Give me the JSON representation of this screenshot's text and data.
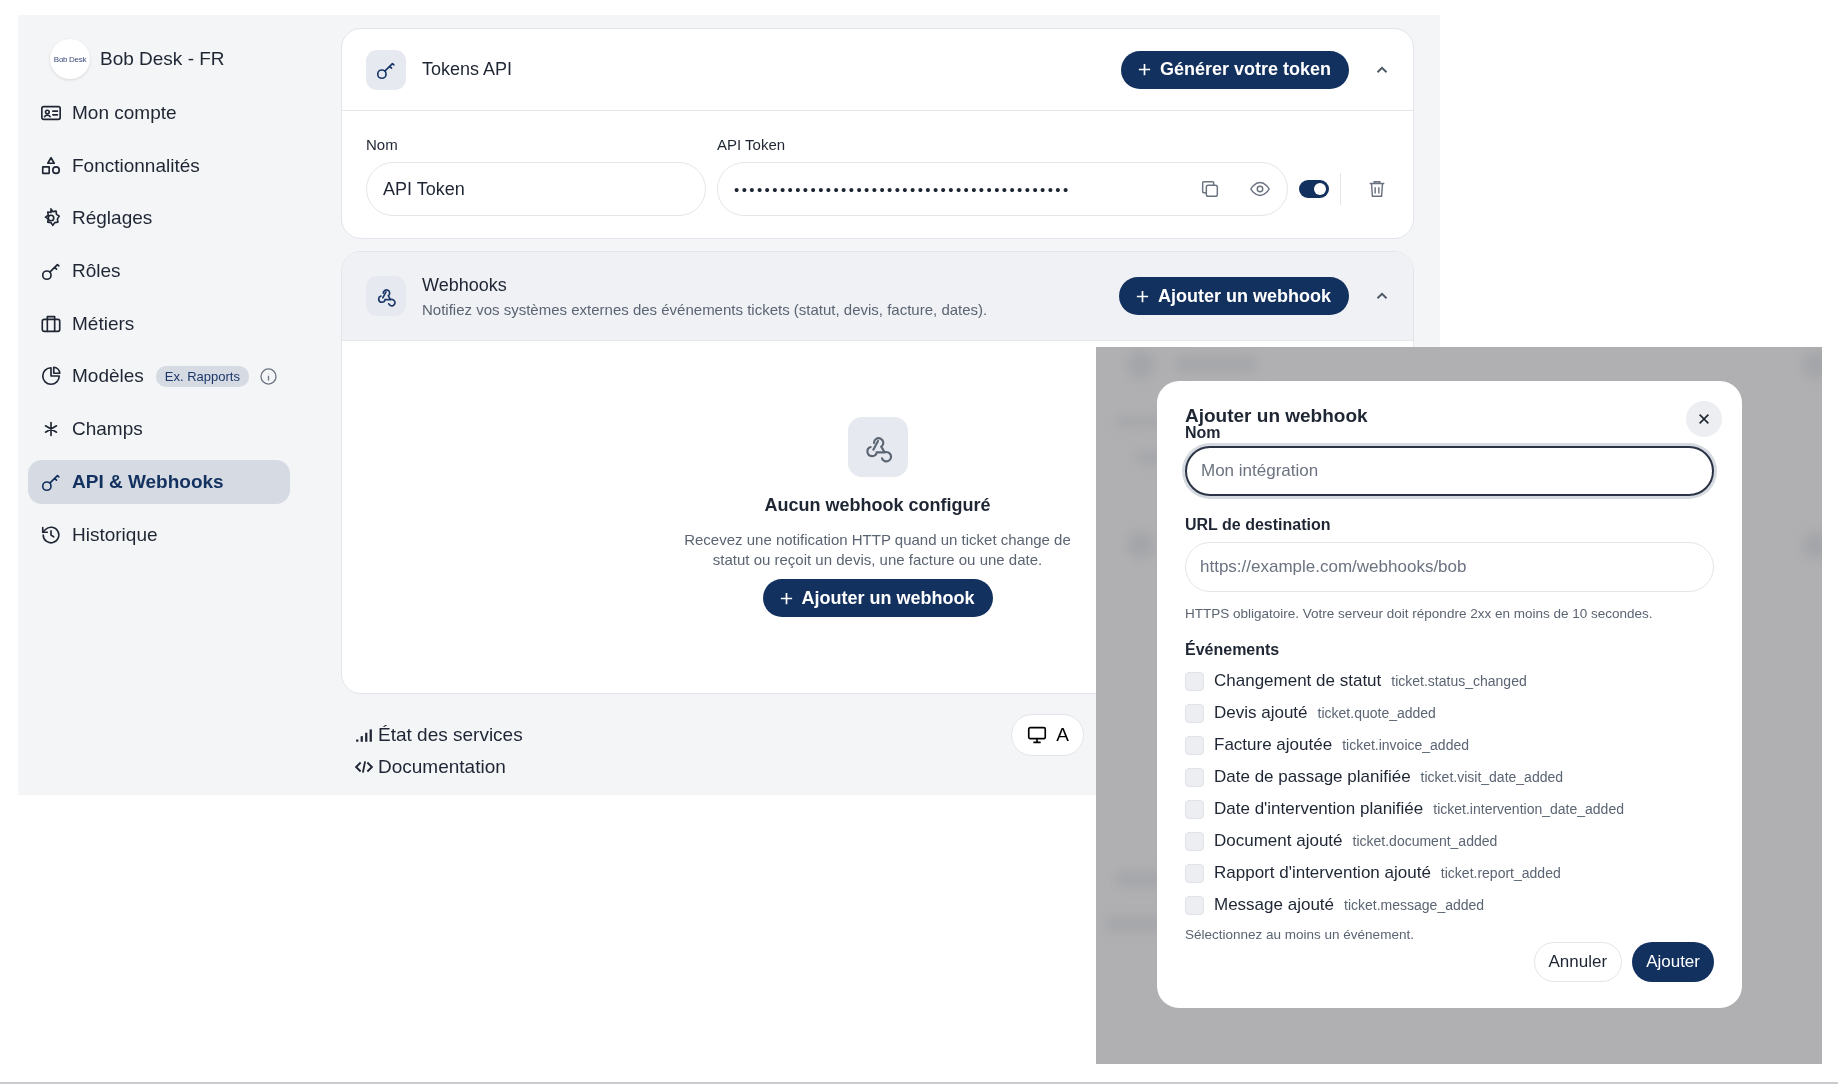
{
  "sidebar": {
    "brand": {
      "logo": "Bob Desk",
      "name": "Bob Desk - FR"
    },
    "items": [
      {
        "label": "Mon compte",
        "selected": false
      },
      {
        "label": "Fonctionnalités",
        "selected": false
      },
      {
        "label": "Réglages",
        "selected": false
      },
      {
        "label": "Rôles",
        "selected": false
      },
      {
        "label": "Métiers",
        "selected": false
      },
      {
        "label": "Modèles",
        "badge": "Ex. Rapports",
        "info": true,
        "selected": false
      },
      {
        "label": "Champs",
        "selected": false
      },
      {
        "label": "API & Webhooks",
        "selected": true
      },
      {
        "label": "Historique",
        "selected": false
      }
    ]
  },
  "tokens": {
    "title": "Tokens API",
    "button": "Générer votre token",
    "expanded": true,
    "columns": [
      "Nom",
      "API Token"
    ],
    "rows": [
      {
        "name": "API Token",
        "token": "••••••••••••••••••••••••••••••••••••••••••••",
        "enabled": true
      }
    ]
  },
  "webhooks": {
    "title": "Webhooks",
    "subtitle": "Notifiez vos systèmes externes des événements tickets (statut, devis, facture, dates).",
    "button": "Ajouter un webhook",
    "expanded": true,
    "empty": {
      "title": "Aucun webhook configuré",
      "text": "Recevez une notification HTTP quand un ticket change de statut ou reçoit un devis, une facture ou une date.",
      "button": "Ajouter un webhook"
    }
  },
  "footer": {
    "links": [
      "État des services",
      "Documentation"
    ],
    "button": "A"
  },
  "modal": {
    "title": "Ajouter un webhook",
    "fields": [
      {
        "label": "Nom",
        "placeholder": "Mon intégration",
        "focused": true
      },
      {
        "label": "URL de destination",
        "placeholder": "https://example.com/webhooks/bob",
        "focused": false
      }
    ],
    "hint": "HTTPS obligatoire. Votre serveur doit répondre 2xx en moins de 10 secondes.",
    "events_label": "Événements",
    "events": [
      {
        "label": "Changement de statut",
        "code": "ticket.status_changed",
        "checked": false
      },
      {
        "label": "Devis ajouté",
        "code": "ticket.quote_added",
        "checked": false
      },
      {
        "label": "Facture ajoutée",
        "code": "ticket.invoice_added",
        "checked": false
      },
      {
        "label": "Date de passage planifiée",
        "code": "ticket.visit_date_added",
        "checked": false
      },
      {
        "label": "Date d'intervention planifiée",
        "code": "ticket.intervention_date_added",
        "checked": false
      },
      {
        "label": "Document ajouté",
        "code": "ticket.document_added",
        "checked": false
      },
      {
        "label": "Rapport d'intervention ajouté",
        "code": "ticket.report_added",
        "checked": false
      },
      {
        "label": "Message ajouté",
        "code": "ticket.message_added",
        "checked": false
      }
    ],
    "error": "Sélectionnez au moins un événement.",
    "buttons": [
      {
        "label": "Annuler",
        "kind": "secondary"
      },
      {
        "label": "Ajouter",
        "kind": "primary"
      }
    ]
  }
}
